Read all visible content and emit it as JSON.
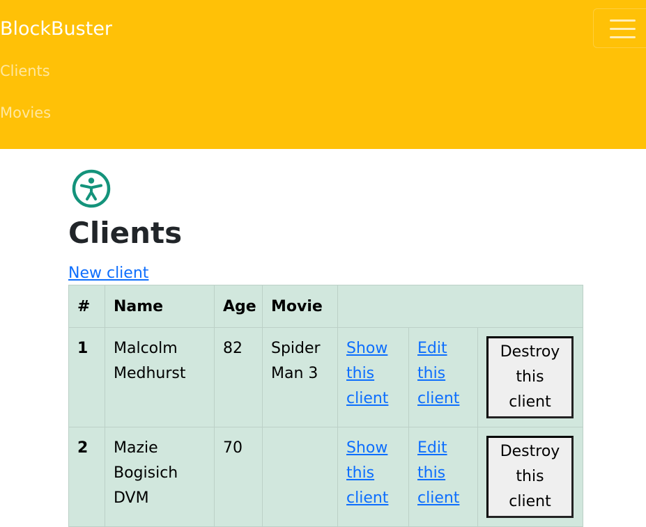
{
  "navbar": {
    "brand": "BlockBuster",
    "links": [
      "Clients",
      "Movies"
    ],
    "toggler_icon": "hamburger-icon",
    "bg_color": "#ffc107"
  },
  "page": {
    "icon": "accessibility-icon",
    "icon_color": "#198754",
    "title": "Clients",
    "new_link": "New client"
  },
  "table": {
    "headers": [
      "#",
      "Name",
      "Age",
      "Movie"
    ],
    "bg_color": "#d1e7dd",
    "rows": [
      {
        "num": "1",
        "name": "Malcolm Medhurst",
        "age": "82",
        "movie": "Spider Man 3",
        "show": "Show this client",
        "edit": "Edit this client",
        "destroy": "Destroy this client"
      },
      {
        "num": "2",
        "name": "Mazie Bogisich DVM",
        "age": "70",
        "movie": "",
        "show": "Show this client",
        "edit": "Edit this client",
        "destroy": "Destroy this client"
      }
    ]
  }
}
